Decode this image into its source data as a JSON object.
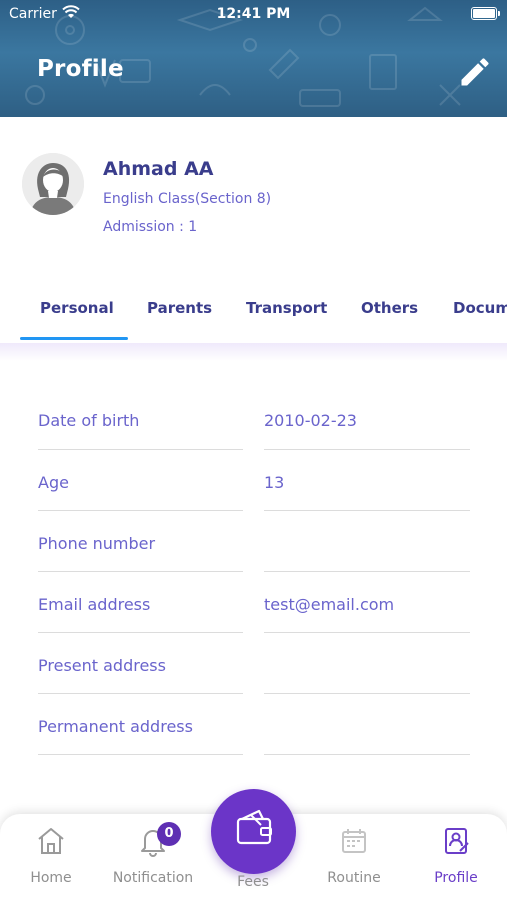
{
  "status_bar": {
    "carrier": "Carrier",
    "time": "12:41 PM"
  },
  "header": {
    "title": "Profile"
  },
  "profile": {
    "name": "Ahmad AA",
    "class_section": "English Class(Section 8)",
    "admission": "Admission : 1"
  },
  "tabs": [
    {
      "label": "Personal",
      "active": true
    },
    {
      "label": "Parents",
      "active": false
    },
    {
      "label": "Transport",
      "active": false
    },
    {
      "label": "Others",
      "active": false
    },
    {
      "label": "Documents",
      "active": false
    }
  ],
  "fields": [
    {
      "label": "Date of birth",
      "value": "2010-02-23"
    },
    {
      "label": "Age",
      "value": "13"
    },
    {
      "label": "Phone number",
      "value": ""
    },
    {
      "label": "Email address",
      "value": "test@email.com"
    },
    {
      "label": "Present address",
      "value": ""
    },
    {
      "label": "Permanent address",
      "value": ""
    }
  ],
  "bottom_nav": {
    "home": "Home",
    "notification": "Notification",
    "notification_count": "0",
    "fees": "Fees",
    "routine": "Routine",
    "profile": "Profile",
    "active": "profile"
  },
  "colors": {
    "header_bg": "#2e5f84",
    "primary_text": "#3a3d8c",
    "secondary_text": "#6a64cc",
    "tab_indicator": "#2196f3",
    "accent_purple": "#6b35c8",
    "nav_inactive": "#8f8f8f"
  },
  "icons": {
    "edit": "pencil-icon",
    "avatar": "female-avatar",
    "home": "home-icon",
    "notification": "bell-icon",
    "fees": "wallet-icon",
    "routine": "calendar-icon",
    "profile": "id-card-icon"
  }
}
